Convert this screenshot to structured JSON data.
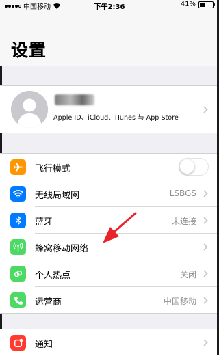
{
  "status_bar": {
    "carrier": "中国移动",
    "time": "下午2:36",
    "battery_percent": "41%",
    "battery_level": 0.41,
    "signal_dots_filled": 4
  },
  "page_title": "设置",
  "profile": {
    "subtitle": "Apple ID、iCloud、iTunes 与 App Store",
    "avatar_icon": "person-icon"
  },
  "settings_group_1": [
    {
      "label": "飞行模式",
      "value": "",
      "icon": "airplane-icon",
      "color": "#ff9500",
      "control": "toggle",
      "toggle_on": false
    },
    {
      "label": "无线局域网",
      "value": "LSBGS",
      "icon": "wifi-icon",
      "color": "#007aff",
      "control": "chevron"
    },
    {
      "label": "蓝牙",
      "value": "未连接",
      "icon": "bluetooth-icon",
      "color": "#007aff",
      "control": "chevron"
    },
    {
      "label": "蜂窝移动网络",
      "value": "",
      "icon": "antenna-icon",
      "color": "#4cd964",
      "control": "chevron"
    },
    {
      "label": "个人热点",
      "value": "关闭",
      "icon": "hotspot-icon",
      "color": "#4cd964",
      "control": "chevron"
    },
    {
      "label": "运营商",
      "value": "中国移动",
      "icon": "phone-icon",
      "color": "#4cd964",
      "control": "chevron"
    }
  ],
  "settings_group_2": [
    {
      "label": "通知",
      "value": "",
      "icon": "notifications-icon",
      "color": "#ff3b30",
      "control": "chevron"
    }
  ],
  "annotation": {
    "icon": "red-arrow-icon",
    "color": "#e8232a"
  }
}
